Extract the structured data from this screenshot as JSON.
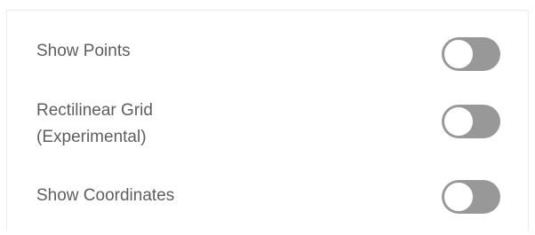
{
  "settings": {
    "colors": {
      "toggle_off": "#989898",
      "toggle_on": "#4a90d9",
      "label_text": "#5e5e5e"
    },
    "rows": [
      {
        "label": "Show Points",
        "toggle_on": false
      },
      {
        "label": "Rectilinear Grid\n(Experimental)",
        "toggle_on": false
      },
      {
        "label": "Show Coordinates",
        "toggle_on": false
      }
    ]
  }
}
